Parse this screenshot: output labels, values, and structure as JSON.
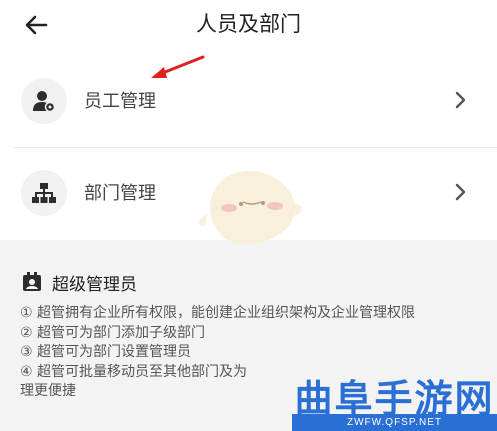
{
  "header": {
    "title": "人员及部门"
  },
  "menu": [
    {
      "label": "员工管理"
    },
    {
      "label": "部门管理"
    }
  ],
  "section": {
    "title": "超级管理员",
    "lines": [
      "① 超管拥有企业所有权限，能创建企业组织架构及企业管理权限",
      "② 超管可为部门添加子级部门",
      "③ 超管可为部门设置管理员",
      "④ 超管可批量移动员至其他部门及为",
      "理更便捷"
    ]
  },
  "watermark": {
    "text": "曲阜手游网",
    "url": "ZWFW.QFSP.NET"
  },
  "colors": {
    "arrow": "#e02020",
    "watermark": "#2a6fd3"
  }
}
